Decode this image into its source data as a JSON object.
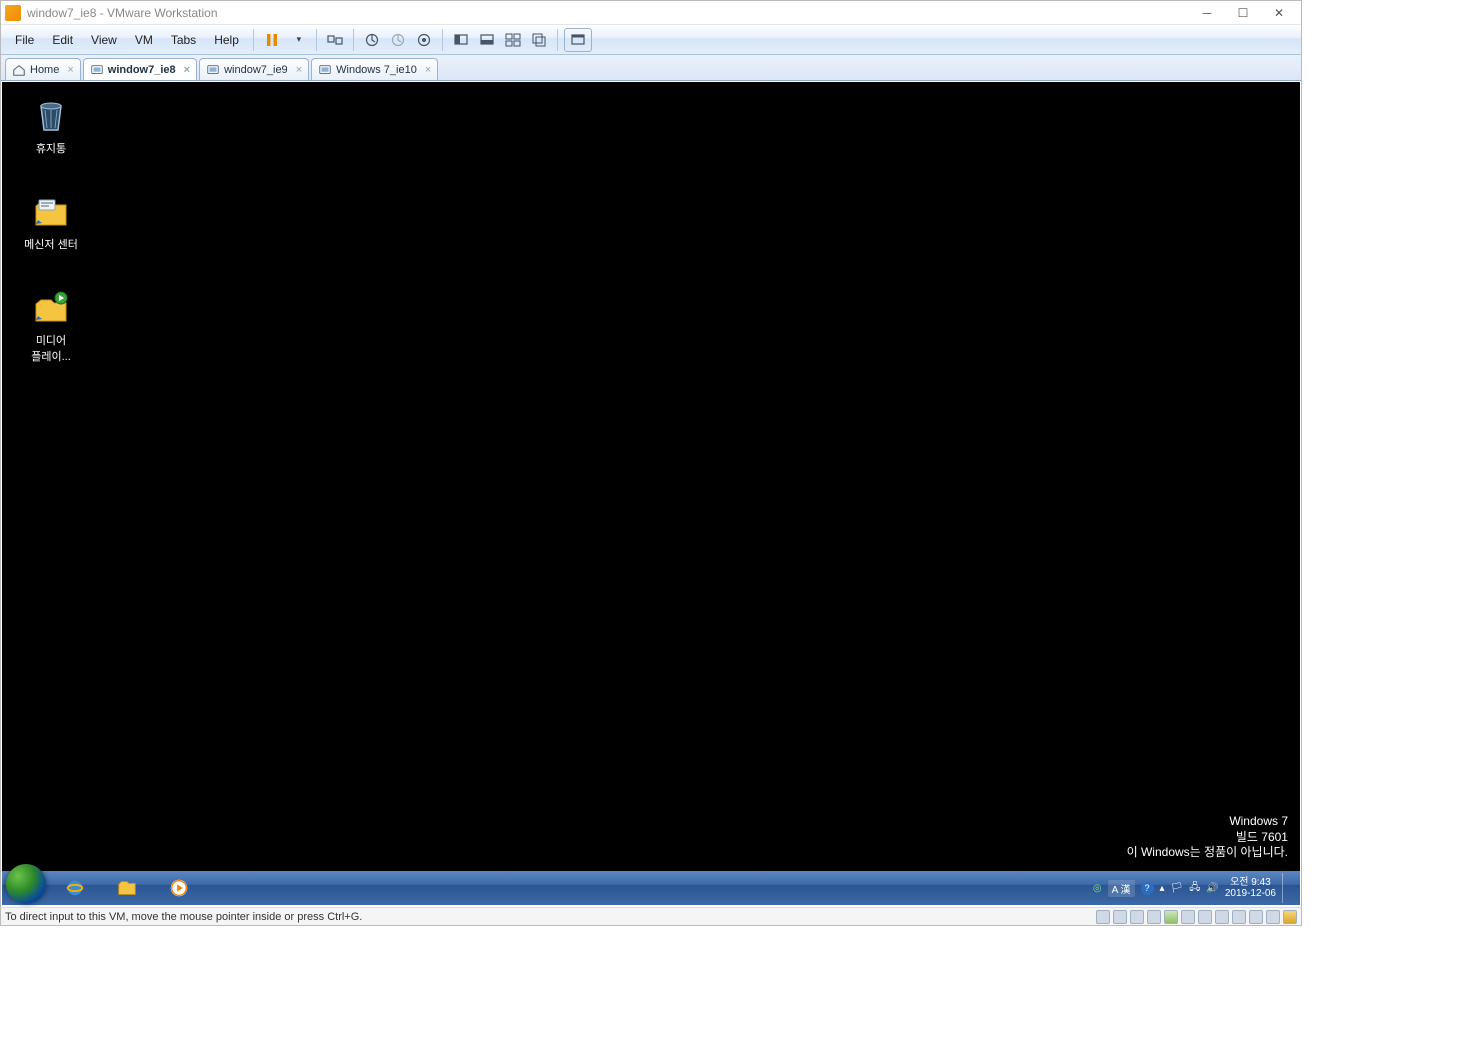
{
  "window": {
    "title": "window7_ie8 - VMware Workstation"
  },
  "menubar": {
    "items": [
      "File",
      "Edit",
      "View",
      "VM",
      "Tabs",
      "Help"
    ]
  },
  "tabs": [
    {
      "label": "Home",
      "active": false,
      "icon": "home"
    },
    {
      "label": "window7_ie8",
      "active": true,
      "icon": "vm"
    },
    {
      "label": "window7_ie9",
      "active": false,
      "icon": "vm"
    },
    {
      "label": "Windows 7_ie10",
      "active": false,
      "icon": "vm"
    }
  ],
  "desktop_icons": [
    {
      "name": "recycle-bin",
      "label": "휴지통"
    },
    {
      "name": "messenger-center",
      "label": "메신저 센터"
    },
    {
      "name": "media-player",
      "label": "미디어\n플레이..."
    }
  ],
  "watermark": {
    "line1": "Windows 7",
    "line2": "빌드 7601",
    "line3": "이 Windows는 정품이 아닙니다."
  },
  "taskbar": {
    "lang": "A 漢",
    "time": "오전 9:43",
    "date": "2019-12-06"
  },
  "statusbar": {
    "hint": "To direct input to this VM, move the mouse pointer inside or press Ctrl+G."
  }
}
